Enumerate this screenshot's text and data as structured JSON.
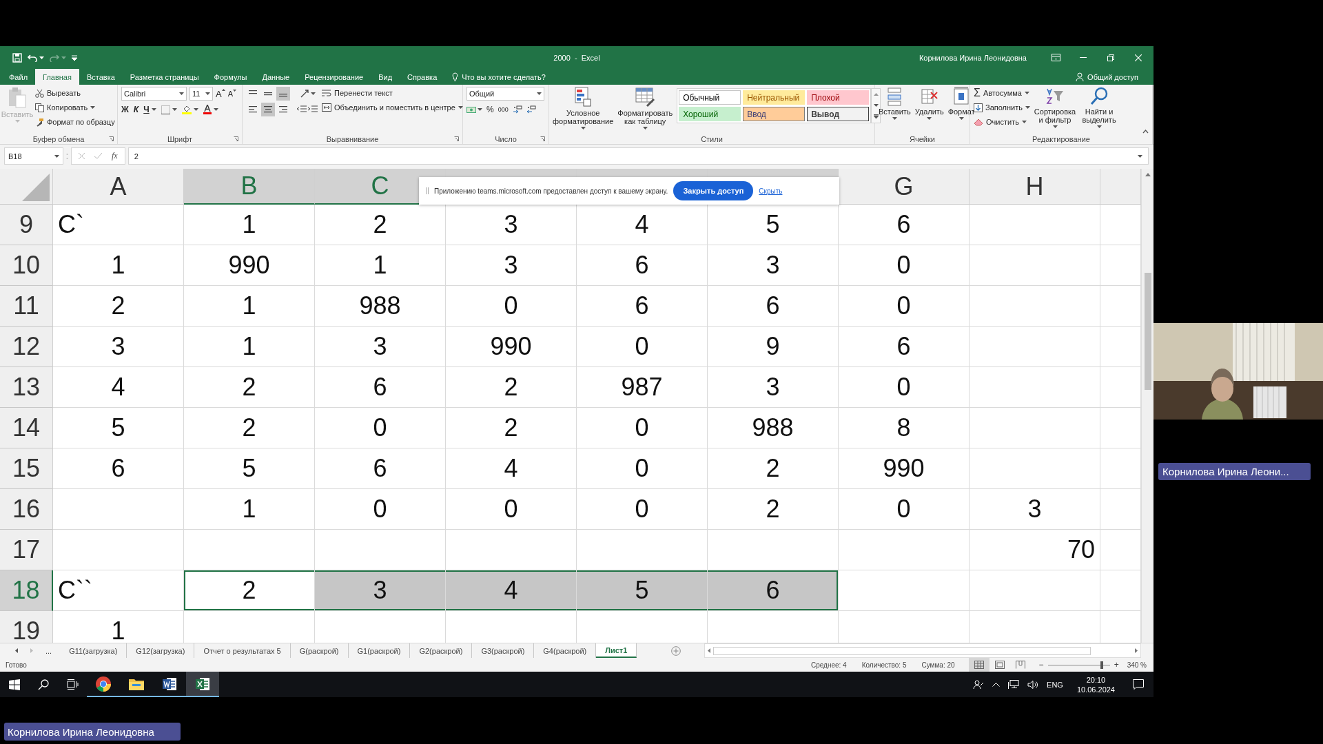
{
  "window": {
    "title": "2000  -  Excel",
    "user": "Корнилова Ирина Леонидовна"
  },
  "ribbon_tabs": [
    {
      "label": "Файл",
      "selected": false
    },
    {
      "label": "Главная",
      "selected": true
    },
    {
      "label": "Вставка",
      "selected": false
    },
    {
      "label": "Разметка страницы",
      "selected": false
    },
    {
      "label": "Формулы",
      "selected": false
    },
    {
      "label": "Данные",
      "selected": false
    },
    {
      "label": "Рецензирование",
      "selected": false
    },
    {
      "label": "Вид",
      "selected": false
    },
    {
      "label": "Справка",
      "selected": false
    }
  ],
  "tell_me": "Что вы хотите сделать?",
  "share_button": "Общий доступ",
  "ribbon": {
    "clipboard": {
      "title": "Буфер обмена",
      "paste": {
        "label": "Вставить",
        "disabled": true
      },
      "cut": "Вырезать",
      "copy": "Копировать",
      "format_painter": "Формат по образцу"
    },
    "font": {
      "title": "Шрифт",
      "font_name": "Calibri",
      "font_size": "11",
      "grow": "A",
      "shrink": "A",
      "bold": "Ж",
      "italic": "К",
      "underline": "Ч"
    },
    "alignment": {
      "title": "Выравнивание",
      "wrap_text": "Перенести текст",
      "merge_center": "Объединить и поместить в центре",
      "bottom_align_on": true,
      "center_align_on": true
    },
    "number": {
      "title": "Число",
      "format": "Общий",
      "percent": "%",
      "thousands": "000"
    },
    "styles": {
      "title": "Стили",
      "conditional": "Условное форматирование",
      "as_table": "Форматировать как таблицу",
      "cell_styles": [
        {
          "label": "Обычный",
          "kind": "normal"
        },
        {
          "label": "Нейтральный",
          "kind": "neutral"
        },
        {
          "label": "Плохой",
          "kind": "bad"
        },
        {
          "label": "Хороший",
          "kind": "good"
        },
        {
          "label": "Ввод",
          "kind": "input"
        },
        {
          "label": "Вывод",
          "kind": "output"
        }
      ]
    },
    "cells": {
      "title": "Ячейки",
      "insert": "Вставить",
      "delete": "Удалить",
      "format": "Формат"
    },
    "editing": {
      "title": "Редактирование",
      "autosum_icon": "Σ",
      "autosum": "Автосумма",
      "fill": "Заполнить",
      "clear": "Очистить",
      "sort": "Сортировка и фильтр",
      "find": "Найти и выделить"
    }
  },
  "formula_bar": {
    "name_box": "B18",
    "fx": "fx",
    "formula": "2"
  },
  "grid": {
    "columns": [
      {
        "label": "A",
        "selected": false
      },
      {
        "label": "B",
        "selected": true
      },
      {
        "label": "C",
        "selected": true
      },
      {
        "selected": true
      },
      {
        "selected": true
      },
      {
        "selected": true
      },
      {
        "label": "G",
        "selected": false
      },
      {
        "label": "H",
        "selected": false
      },
      {
        "selected": false
      }
    ],
    "rows": [
      {
        "header": "9",
        "selected": false,
        "cells": [
          {
            "text": "C`",
            "align_left": true
          },
          "1",
          "2",
          "3",
          "4",
          "5",
          "6"
        ]
      },
      {
        "header": "10",
        "selected": false,
        "cells": [
          "1",
          "990",
          "1",
          "3",
          "6",
          "3",
          "0"
        ]
      },
      {
        "header": "11",
        "selected": false,
        "cells": [
          "2",
          "1",
          "988",
          "0",
          "6",
          "6",
          "0"
        ]
      },
      {
        "header": "12",
        "selected": false,
        "cells": [
          "3",
          "1",
          "3",
          "990",
          "0",
          "9",
          "6"
        ]
      },
      {
        "header": "13",
        "selected": false,
        "cells": [
          "4",
          "2",
          "6",
          "2",
          "987",
          "3",
          "0"
        ]
      },
      {
        "header": "14",
        "selected": false,
        "cells": [
          "5",
          "2",
          "0",
          "2",
          "0",
          "988",
          "8"
        ]
      },
      {
        "header": "15",
        "selected": false,
        "cells": [
          "6",
          "5",
          "6",
          "4",
          "0",
          "2",
          "990"
        ]
      },
      {
        "header": "16",
        "selected": false,
        "cells": [
          null,
          "1",
          "0",
          "0",
          "0",
          "2",
          "0",
          "3"
        ]
      },
      {
        "header": "17",
        "selected": false,
        "cells": [
          null,
          null,
          null,
          null,
          null,
          null,
          null,
          {
            "text": "70",
            "align_right": true
          }
        ]
      },
      {
        "header": "18",
        "selected": true,
        "cells": [
          {
            "text": "C``",
            "align_left": true
          },
          {
            "text": "2",
            "active": true
          },
          "3",
          "4",
          "5",
          "6"
        ]
      },
      {
        "header": "19",
        "selected": false,
        "cells": [
          "1"
        ]
      }
    ]
  },
  "share_banner": {
    "message": "Приложению teams.microsoft.com предоставлен доступ к вашему экрану.",
    "stop_button": "Закрыть доступ",
    "hide_link": "Скрыть"
  },
  "sheet_tabs": {
    "more": "...",
    "tabs": [
      {
        "label": "G11(загрузка)",
        "selected": false
      },
      {
        "label": "G12(загрузка)",
        "selected": false
      },
      {
        "label": "Отчет о результатах 5",
        "selected": false
      },
      {
        "label": "G(раскрой)",
        "selected": false
      },
      {
        "label": "G1(раскрой)",
        "selected": false
      },
      {
        "label": "G2(раскрой)",
        "selected": false
      },
      {
        "label": "G3(раскрой)",
        "selected": false
      },
      {
        "label": "G4(раскрой)",
        "selected": false
      },
      {
        "label": "Лист1",
        "selected": true
      }
    ]
  },
  "status_bar": {
    "status": "Готово",
    "stats": [
      "Среднее: 4",
      "Количество: 5",
      "Сумма: 20"
    ],
    "views": [
      {
        "kind": "normal",
        "selected": true
      },
      {
        "kind": "page_layout",
        "selected": false
      },
      {
        "kind": "page_break",
        "selected": false
      }
    ],
    "zoom": {
      "minus": "−",
      "plus": "+",
      "level": 0.87,
      "reading": "340 %"
    }
  },
  "taskbar": {
    "apps": [
      {
        "kind": "chrome",
        "active": false
      },
      {
        "kind": "explorer",
        "active": false
      },
      {
        "kind": "word",
        "active": false
      },
      {
        "kind": "excel",
        "active": true
      }
    ],
    "language": "ENG",
    "time": "20:10",
    "date": "10.06.2024"
  },
  "video": {
    "kind": "picture",
    "name": "Корнилова Ирина Леони..."
  },
  "presenter_name": "Корнилова Ирина Леонидовна"
}
